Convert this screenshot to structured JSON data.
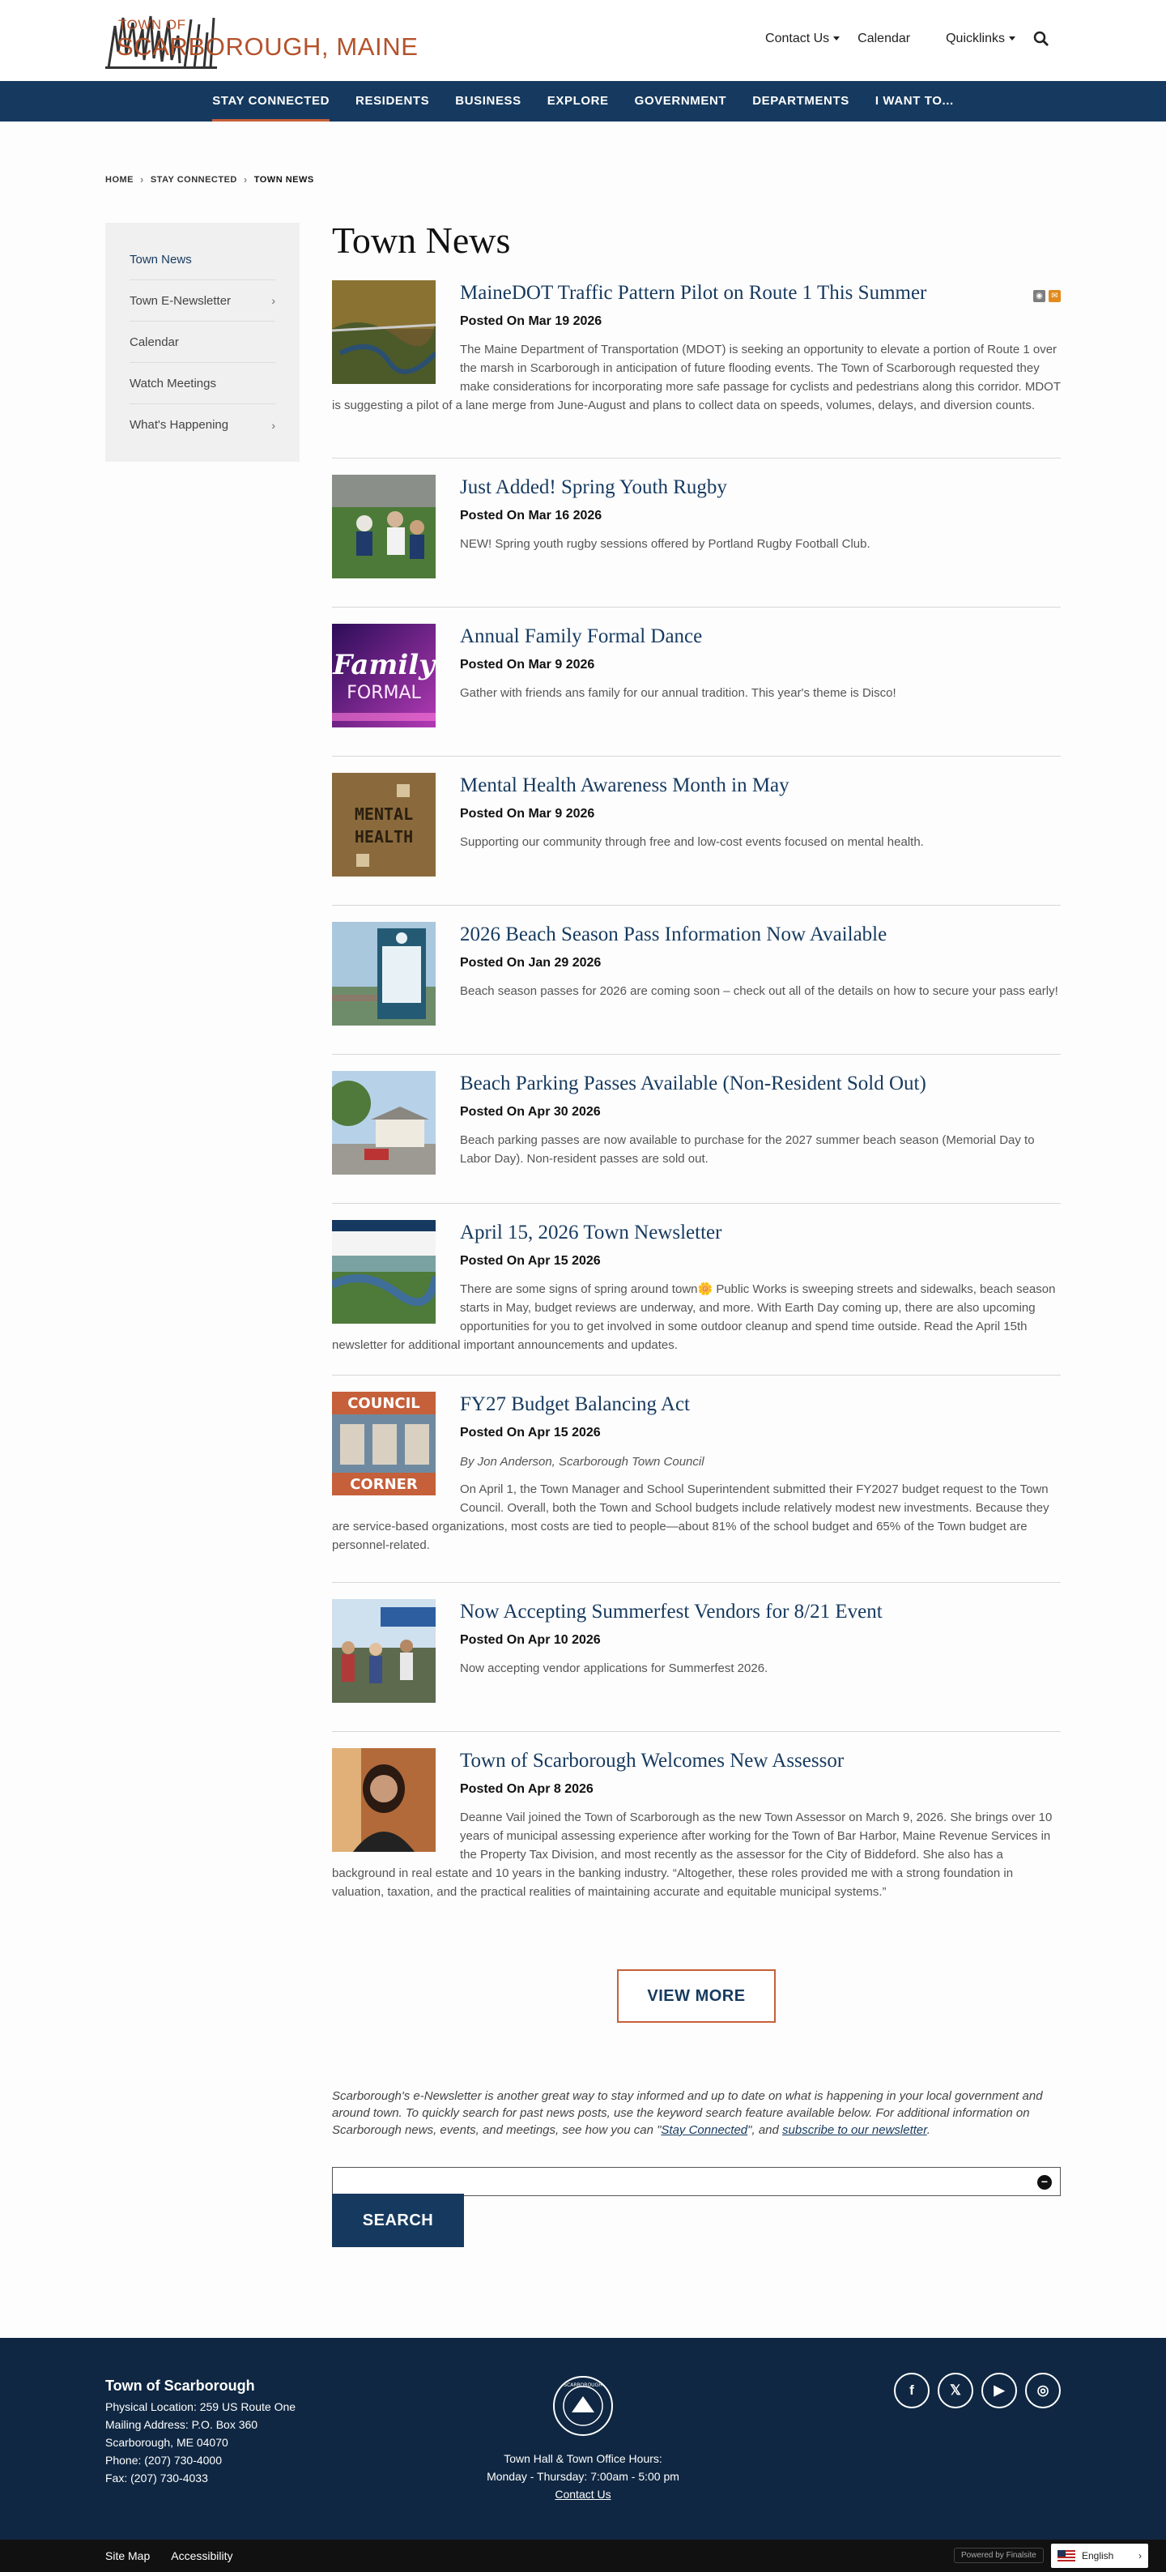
{
  "header": {
    "logo_town_of": "TOWN OF",
    "logo_name": "SCARBOROUGH, MAINE",
    "util": {
      "contact": "Contact Us",
      "calendar": "Calendar",
      "quicklinks": "Quicklinks"
    }
  },
  "nav": [
    "STAY CONNECTED",
    "RESIDENTS",
    "BUSINESS",
    "EXPLORE",
    "GOVERNMENT",
    "DEPARTMENTS",
    "I WANT TO..."
  ],
  "breadcrumb": {
    "home": "HOME",
    "parent": "STAY CONNECTED",
    "current": "TOWN NEWS"
  },
  "sidebar": [
    "Town News",
    "Town E-Newsletter",
    "Calendar",
    "Watch Meetings",
    "What's Happening"
  ],
  "page_title": "Town News",
  "news": [
    {
      "title": "MaineDOT Traffic Pattern Pilot on Route 1 This Summer",
      "date": "Posted On Mar 19 2026",
      "byline": "",
      "body": "The Maine Department of Transportation (MDOT) is seeking an opportunity to elevate a portion of Route 1 over the marsh in Scarborough in anticipation of future flooding events. The Town of Scarborough requested they make considerations for incorporating more safe passage for cyclists and pedestrians along this corridor. MDOT is suggesting a pilot of a lane merge from June-August and plans to collect data on speeds, volumes, delays, and diversion counts."
    },
    {
      "title": "Just Added! Spring Youth Rugby",
      "date": "Posted On Mar 16 2026",
      "byline": "",
      "body": "NEW! Spring youth rugby sessions offered by Portland Rugby Football Club."
    },
    {
      "title": "Annual Family Formal Dance",
      "date": "Posted On Mar 9 2026",
      "byline": "",
      "body": "Gather with friends ans family for our annual tradition. This year's theme is Disco!"
    },
    {
      "title": "Mental Health Awareness Month in May",
      "date": "Posted On Mar 9 2026",
      "byline": "",
      "body": "Supporting our community through free and low-cost events focused on mental health."
    },
    {
      "title": "2026 Beach Season Pass Information Now Available",
      "date": "Posted On Jan 29 2026",
      "byline": "",
      "body": "Beach season passes for 2026 are coming soon – check out all of the details on how to secure your pass early!"
    },
    {
      "title": "Beach Parking Passes Available (Non-Resident Sold Out)",
      "date": "Posted On Apr 30 2026",
      "byline": "",
      "body": "Beach parking passes are now available to purchase for the 2027 summer beach season (Memorial Day to Labor Day). Non-resident passes are sold out."
    },
    {
      "title": "April 15, 2026 Town Newsletter",
      "date": "Posted On Apr 15 2026",
      "byline": "",
      "body": "There are some signs of spring around town🌼 Public Works is sweeping streets and sidewalks, beach season starts in May, budget reviews are underway, and more. With Earth Day coming up, there are also upcoming opportunities for you to get involved in some outdoor cleanup and spend time outside. Read the April 15th newsletter for additional important announcements and updates."
    },
    {
      "title": "FY27 Budget Balancing Act",
      "date": "Posted On Apr 15 2026",
      "byline": "By Jon Anderson, Scarborough Town Council",
      "body": "On April 1, the Town Manager and School Superintendent submitted their FY2027 budget request to the Town Council. Overall, both the Town and School budgets include relatively modest new investments. Because they are service-based organizations, most costs are tied to people—about 81% of the school budget and 65% of the Town budget are personnel-related."
    },
    {
      "title": "Now Accepting Summerfest Vendors for 8/21 Event",
      "date": "Posted On Apr 10 2026",
      "byline": "",
      "body": "Now accepting vendor applications for Summerfest 2026."
    },
    {
      "title": "Town of Scarborough Welcomes New Assessor",
      "date": "Posted On Apr 8 2026",
      "byline": "",
      "body": "Deanne Vail joined the Town of Scarborough as the new Town Assessor on March 9, 2026. She brings over 10 years of municipal assessing experience after working for the Town of Bar Harbor, Maine Revenue Services in the Property Tax Division, and most recently as the assessor for the City of Biddeford. She also has a background in real estate and 10 years in the banking industry. “Altogether, these roles provided me with a strong foundation in valuation, taxation, and the practical realities of maintaining accurate and equitable municipal systems.”"
    }
  ],
  "thumb_text": {
    "family": "Family",
    "formal": "FORMAL",
    "mental": "MENTAL",
    "health": "HEALTH",
    "council": "COUNCIL",
    "corner": "CORNER"
  },
  "view_more": "VIEW MORE",
  "promo": {
    "text1": "Scarborough's e-Newsletter is another great way to stay informed and up to date on what is happening in your local government and around town. To quickly search for past news posts, use the keyword search feature available below. For additional information on Scarborough news, events, and meetings, see how you can \"",
    "link1": "Stay Connected",
    "text2": "\", and ",
    "link2": "subscribe to our newsletter",
    "text3": "."
  },
  "search": {
    "placeholder": "",
    "button": "SEARCH",
    "clear": "−"
  },
  "footer": {
    "org": "Town of Scarborough",
    "physical": "Physical Location: 259 US Route One",
    "mailing": "Mailing Address: P.O. Box 360",
    "city": "Scarborough, ME 04070",
    "phone": "Phone: (207) 730-4000",
    "fax": "Fax: (207) 730-4033",
    "hours_title": "Town Hall & Town Office Hours:",
    "hours": "Monday - Thursday: 7:00am - 5:00 pm",
    "contact": "Contact Us",
    "seal_text": "SCARBOROUGH"
  },
  "bottom": {
    "sitemap": "Site Map",
    "accessibility": "Accessibility",
    "powered": "Powered by Finalsite",
    "language": "English"
  },
  "colors": {
    "navy": "#163a5f",
    "rust": "#c5603a",
    "footer": "#0f2742"
  }
}
